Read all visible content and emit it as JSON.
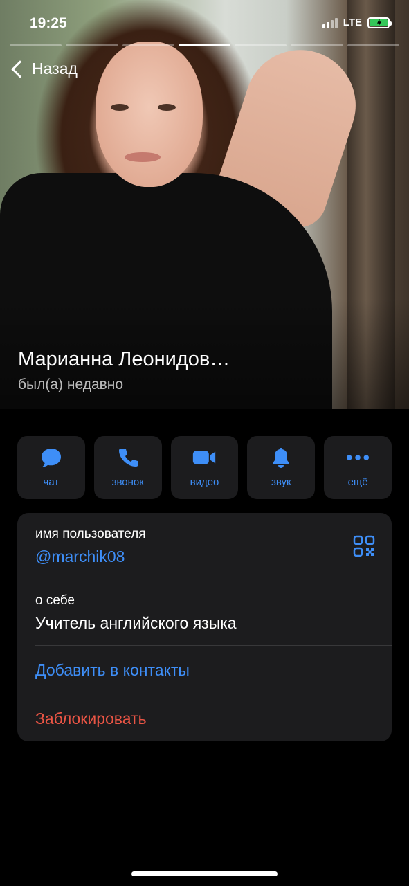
{
  "status_bar": {
    "time": "19:25",
    "network": "LTE",
    "battery_color": "#35c759"
  },
  "header": {
    "back_label": "Назад",
    "story_segments": 7,
    "active_segment": 4
  },
  "profile": {
    "name": "Марианна Леонидов…",
    "status": "был(а) недавно"
  },
  "actions": [
    {
      "label": "чат",
      "icon": "chat-bubble-icon"
    },
    {
      "label": "звонок",
      "icon": "phone-icon"
    },
    {
      "label": "видео",
      "icon": "video-camera-icon"
    },
    {
      "label": "звук",
      "icon": "bell-icon"
    },
    {
      "label": "ещё",
      "icon": "more-dots-icon"
    }
  ],
  "info": {
    "username_label": "имя пользователя",
    "username_value": "@marchik08",
    "about_label": "о себе",
    "about_value": "Учитель английского языка",
    "add_contact": "Добавить в контакты",
    "block": "Заблокировать"
  },
  "colors": {
    "accent": "#3e8ef7",
    "danger": "#eb5545",
    "card_bg": "#1c1c1e"
  }
}
